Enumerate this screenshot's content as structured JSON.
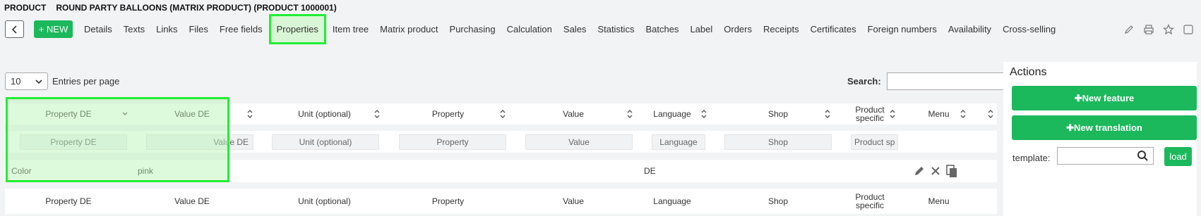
{
  "header": {
    "section": "PRODUCT",
    "title": "ROUND PARTY BALLOONS (MATRIX PRODUCT) (PRODUCT 1000001)"
  },
  "toolbar": {
    "new_label": "+ NEW",
    "tabs": [
      "Details",
      "Texts",
      "Links",
      "Files",
      "Free fields",
      "Properties",
      "Item tree",
      "Matrix product",
      "Purchasing",
      "Calculation",
      "Sales",
      "Statistics",
      "Batches",
      "Label",
      "Orders",
      "Receipts",
      "Certificates",
      "Foreign numbers",
      "Availability",
      "Cross-selling"
    ],
    "active_tab": "Properties",
    "icons": [
      "pencil-icon",
      "printer-icon",
      "star-icon",
      "square-icon"
    ]
  },
  "list": {
    "entries_value": "10",
    "entries_label": "Entries per page",
    "search_label": "Search:",
    "columns": [
      "Property DE",
      "Value DE",
      "Unit (optional)",
      "Property",
      "Value",
      "Language",
      "Shop",
      "Product specific",
      "Menu"
    ],
    "filters": [
      "Property DE",
      "Value DE",
      "Unit (optional)",
      "Property",
      "Value",
      "Language",
      "Shop",
      "Product sp"
    ],
    "row": {
      "property_de": "Color",
      "value_de": "pink",
      "language": "DE"
    }
  },
  "actions": {
    "title": "Actions",
    "new_feature": "New feature",
    "new_translation": "New translation",
    "template_label": "template:",
    "load_label": "load"
  },
  "colors": {
    "accent": "#1cb85c",
    "highlight": "#22ee33"
  }
}
